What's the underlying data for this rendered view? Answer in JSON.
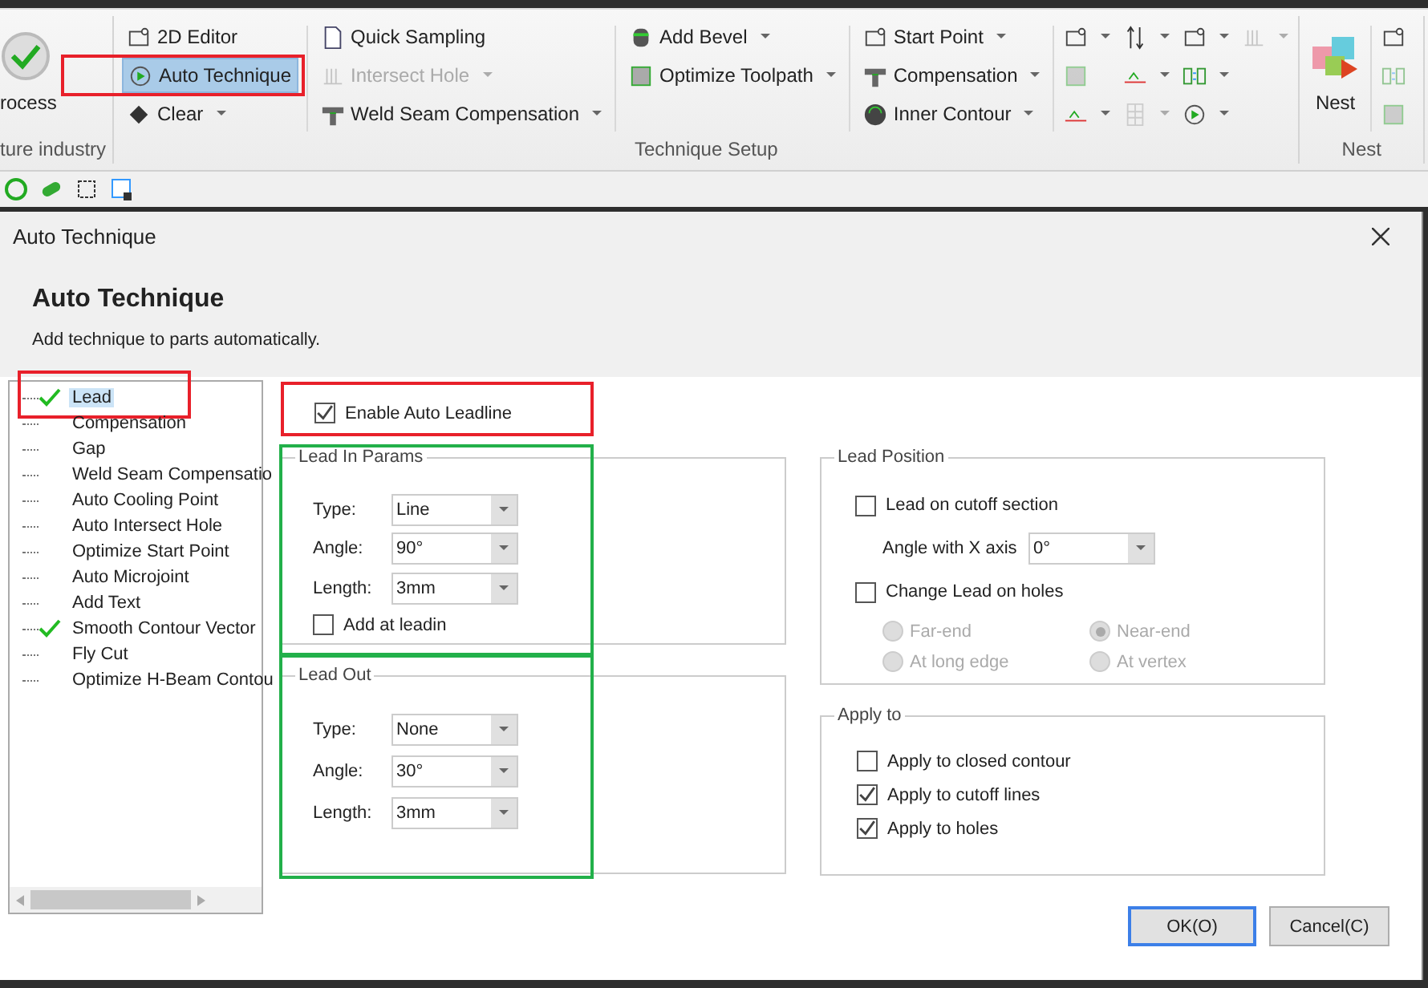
{
  "ribbon": {
    "groups": [
      {
        "label": "ture industry",
        "columns": [
          {
            "kind": "large",
            "items": [
              {
                "label": "rocess",
                "dropdown": false,
                "disabled": false,
                "selected": false
              }
            ]
          }
        ]
      },
      {
        "label": "Technique Setup",
        "columns": [
          {
            "kind": "small",
            "items": [
              {
                "label": "2D Editor",
                "dropdown": false,
                "disabled": false,
                "selected": false
              },
              {
                "label": "Auto Technique",
                "dropdown": false,
                "disabled": false,
                "selected": true,
                "highlighted": true
              },
              {
                "label": "Clear",
                "dropdown": true,
                "disabled": false,
                "selected": false
              }
            ]
          },
          {
            "kind": "small",
            "items": [
              {
                "label": "Quick Sampling",
                "dropdown": false,
                "disabled": false,
                "selected": false
              },
              {
                "label": "Intersect Hole",
                "dropdown": true,
                "disabled": true,
                "selected": false
              },
              {
                "label": "Weld Seam Compensation",
                "dropdown": true,
                "disabled": false,
                "selected": false
              }
            ]
          },
          {
            "kind": "small",
            "items": [
              {
                "label": "Add Bevel",
                "dropdown": true,
                "disabled": false,
                "selected": false
              },
              {
                "label": "Optimize Toolpath",
                "dropdown": true,
                "disabled": false,
                "selected": false
              }
            ]
          },
          {
            "kind": "small",
            "items": [
              {
                "label": "Start Point",
                "dropdown": true,
                "disabled": false,
                "selected": false
              },
              {
                "label": "Compensation",
                "dropdown": true,
                "disabled": false,
                "selected": false
              },
              {
                "label": "Inner Contour",
                "dropdown": true,
                "disabled": false,
                "selected": false
              }
            ]
          },
          {
            "kind": "icons",
            "items": [
              {
                "dropdown": true,
                "disabled": false,
                "selected": false
              },
              {
                "dropdown": false,
                "disabled": true,
                "selected": false
              },
              {
                "dropdown": true,
                "disabled": false,
                "selected": false
              }
            ]
          },
          {
            "kind": "icons",
            "items": [
              {
                "dropdown": true,
                "disabled": false,
                "selected": false
              },
              {
                "dropdown": true,
                "disabled": false,
                "selected": false
              },
              {
                "dropdown": true,
                "disabled": true,
                "selected": false
              }
            ]
          },
          {
            "kind": "icons",
            "items": [
              {
                "dropdown": true,
                "disabled": false,
                "selected": false
              },
              {
                "dropdown": true,
                "disabled": false,
                "selected": false
              },
              {
                "dropdown": true,
                "disabled": false,
                "selected": false
              }
            ]
          },
          {
            "kind": "icons",
            "items": [
              {
                "dropdown": true,
                "disabled": true,
                "selected": false
              }
            ]
          }
        ]
      },
      {
        "label": "Nest",
        "columns": [
          {
            "kind": "large",
            "items": [
              {
                "label": "Nest",
                "dropdown": false,
                "disabled": false,
                "selected": false
              }
            ]
          },
          {
            "kind": "icons",
            "items": [
              {
                "dropdown": false,
                "disabled": false,
                "selected": false
              },
              {
                "dropdown": false,
                "disabled": true,
                "selected": false
              },
              {
                "dropdown": false,
                "disabled": true,
                "selected": false
              }
            ]
          }
        ]
      }
    ]
  },
  "dialog": {
    "title": "Auto Technique",
    "heading": "Auto Technique",
    "description": "Add technique to parts automatically.",
    "tree": [
      {
        "label": "Lead",
        "checked": true,
        "selected": true,
        "highlighted": true
      },
      {
        "label": "Compensation",
        "checked": false,
        "selected": false
      },
      {
        "label": "Gap",
        "checked": false,
        "selected": false
      },
      {
        "label": "Weld Seam Compensatio",
        "checked": false,
        "selected": false
      },
      {
        "label": "Auto Cooling Point",
        "checked": false,
        "selected": false
      },
      {
        "label": "Auto Intersect Hole",
        "checked": false,
        "selected": false
      },
      {
        "label": "Optimize Start Point",
        "checked": false,
        "selected": false
      },
      {
        "label": "Auto Microjoint",
        "checked": false,
        "selected": false
      },
      {
        "label": "Add Text",
        "checked": false,
        "selected": false
      },
      {
        "label": "Smooth Contour Vector",
        "checked": true,
        "selected": false
      },
      {
        "label": "Fly Cut",
        "checked": false,
        "selected": false
      },
      {
        "label": "Optimize H-Beam Contou",
        "checked": false,
        "selected": false
      }
    ],
    "enable_auto_leadline": {
      "label": "Enable Auto Leadline",
      "checked": true,
      "highlighted": true
    },
    "lead_in": {
      "title": "Lead In Params",
      "highlighted": true,
      "fields": [
        {
          "label": "Type:",
          "value": "Line"
        },
        {
          "label": "Angle:",
          "value": "90°"
        },
        {
          "label": "Length:",
          "value": "3mm"
        }
      ],
      "add_at_leadin": {
        "label": "Add at leadin",
        "checked": false
      }
    },
    "lead_out": {
      "title": "Lead Out",
      "highlighted": true,
      "fields": [
        {
          "label": "Type:",
          "value": "None"
        },
        {
          "label": "Angle:",
          "value": "30°"
        },
        {
          "label": "Length:",
          "value": "3mm"
        }
      ]
    },
    "lead_position": {
      "title": "Lead Position",
      "lead_on_cutoff": {
        "label": "Lead on cutoff section",
        "checked": false
      },
      "angle_with_x": {
        "label": "Angle with X axis",
        "value": "0°"
      },
      "change_lead_on_holes": {
        "label": "Change Lead on holes",
        "checked": false
      },
      "radios": [
        {
          "label": "Far-end",
          "selected": false,
          "disabled": true
        },
        {
          "label": "Near-end",
          "selected": true,
          "disabled": true
        },
        {
          "label": "At long edge",
          "selected": false,
          "disabled": true
        },
        {
          "label": "At vertex",
          "selected": false,
          "disabled": true
        }
      ]
    },
    "apply_to": {
      "title": "Apply to",
      "options": [
        {
          "label": "Apply to closed contour",
          "checked": false
        },
        {
          "label": "Apply to cutoff lines",
          "checked": true
        },
        {
          "label": "Apply to holes",
          "checked": true
        }
      ]
    },
    "buttons": [
      {
        "label": "OK(O)",
        "default": true
      },
      {
        "label": "Cancel(C)",
        "default": false
      }
    ]
  }
}
